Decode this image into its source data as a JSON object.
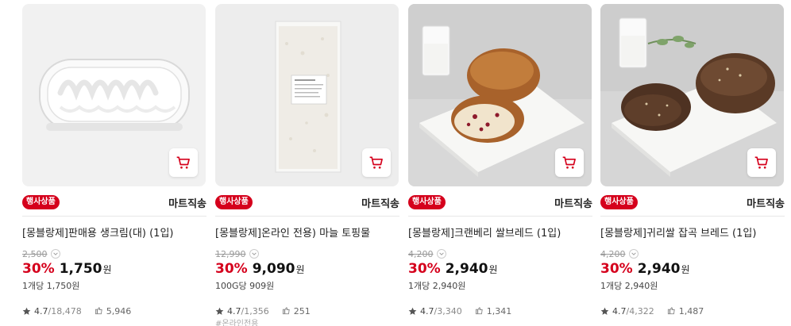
{
  "products": [
    {
      "badge": "행사상품",
      "delivery": "마트직송",
      "title": "[몽블랑제]판매용 생크림(대) (1입)",
      "original_price": "2,500",
      "discount_rate": "30%",
      "price": "1,750",
      "currency": "원",
      "unit_price": "1개당 1,750원",
      "rating": "4.7",
      "review_count": "/18,478",
      "purchase_count": "5,946",
      "extra": "",
      "image_icon": "whipped-cream-package-image"
    },
    {
      "badge": "행사상품",
      "delivery": "마트직송",
      "title": "[몽블랑제]온라인 전용) 마늘 토핑물",
      "original_price": "12,990",
      "discount_rate": "30%",
      "price": "9,090",
      "currency": "원",
      "unit_price": "100G당 909원",
      "rating": "4.7",
      "review_count": "/1,356",
      "purchase_count": "251",
      "extra": "#온라인전용",
      "image_icon": "garlic-topping-package-image"
    },
    {
      "badge": "행사상품",
      "delivery": "마트직송",
      "title": "[몽블랑제]크랜베리 쌀브레드 (1입)",
      "original_price": "4,200",
      "discount_rate": "30%",
      "price": "2,940",
      "currency": "원",
      "unit_price": "1개당 2,940원",
      "rating": "4.7",
      "review_count": "/3,340",
      "purchase_count": "1,341",
      "extra": "",
      "image_icon": "cranberry-bread-image"
    },
    {
      "badge": "행사상품",
      "delivery": "마트직송",
      "title": "[몽블랑제]귀리쌀 잡곡 브레드 (1입)",
      "original_price": "4,200",
      "discount_rate": "30%",
      "price": "2,940",
      "currency": "원",
      "unit_price": "1개당 2,940원",
      "rating": "4.7",
      "review_count": "/4,322",
      "purchase_count": "1,487",
      "extra": "",
      "image_icon": "oat-grain-bread-image"
    }
  ],
  "colors": {
    "accent_red": "#d5001c",
    "text_dark": "#222222",
    "text_muted": "#999999"
  }
}
